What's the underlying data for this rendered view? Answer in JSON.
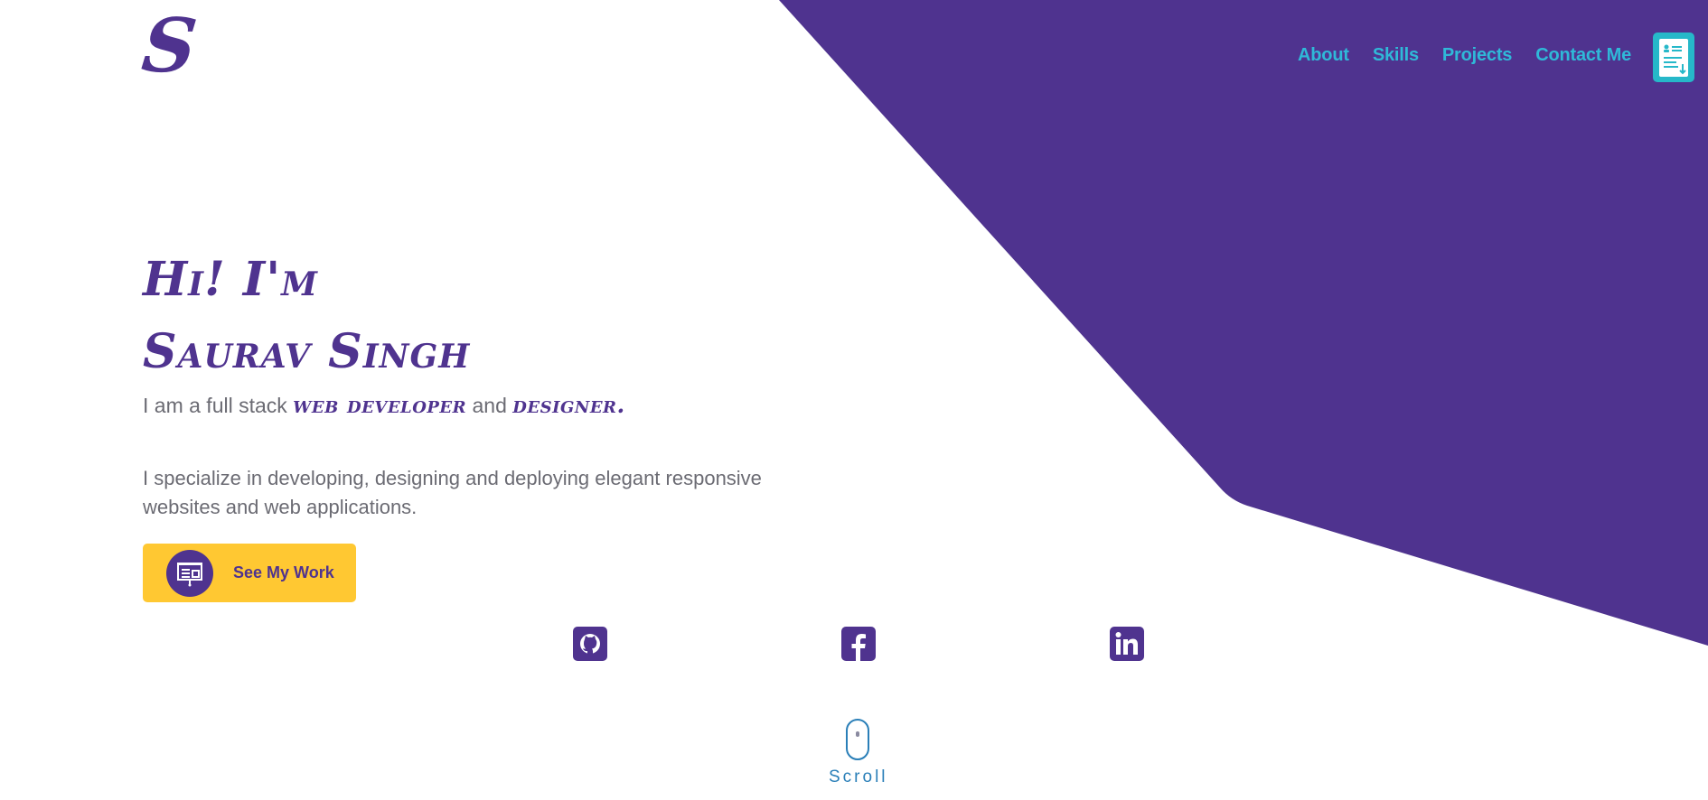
{
  "brand": {
    "logo_letter": "S",
    "primary_color": "#4f338f",
    "accent_color": "#2fb9d8",
    "cta_color": "#ffc832"
  },
  "nav": {
    "items": [
      {
        "label": "About"
      },
      {
        "label": "Skills"
      },
      {
        "label": "Projects"
      },
      {
        "label": "Contact Me"
      }
    ],
    "resume_icon": "resume-download-icon"
  },
  "hero": {
    "greeting": "Hi! I'm",
    "name": "Saurav Singh",
    "tagline_prefix": "I am a full stack",
    "role_1": "web developer",
    "tagline_join": "and",
    "role_2": "designer."
  },
  "bio": {
    "text": "I specialize in developing, designing and deploying elegant responsive websites and web applications."
  },
  "cta": {
    "label": "See My Work",
    "icon": "presentation-icon"
  },
  "social": [
    {
      "name": "github",
      "icon": "github-icon"
    },
    {
      "name": "facebook",
      "icon": "facebook-icon"
    },
    {
      "name": "linkedin",
      "icon": "linkedin-icon"
    }
  ],
  "scroll": {
    "label": "Scroll",
    "icon": "mouse-icon"
  }
}
